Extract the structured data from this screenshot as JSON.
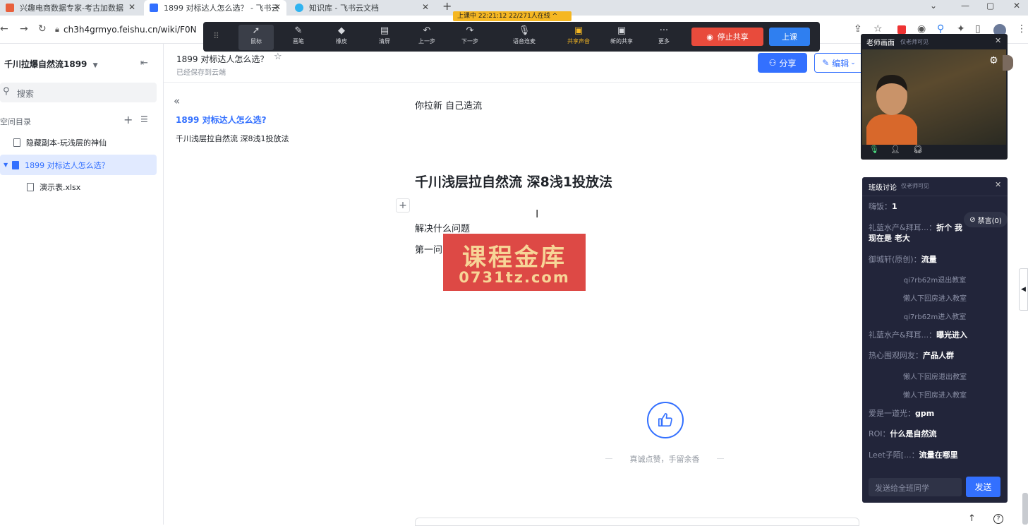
{
  "browser": {
    "tabs": [
      {
        "title": "兴趣电商数据专家-考古加数据",
        "fav_color": "#e8603c"
      },
      {
        "title": "1899 对标达人怎么选？ - 飞书云",
        "fav_color": "#3370ff"
      },
      {
        "title": "知识库 - 飞书云文档",
        "fav_color": "#2fb3f0"
      }
    ],
    "url": "ch3h4grmyo.feishu.cn/wiki/F0N"
  },
  "teach_toolbar": {
    "live_badge": "上课中 22:21:12 22/271人在线 ^",
    "tools": [
      {
        "label": "鼠标",
        "icon": "cursor-icon"
      },
      {
        "label": "画笔",
        "icon": "pen-icon"
      },
      {
        "label": "橡皮",
        "icon": "eraser-icon"
      },
      {
        "label": "清屏",
        "icon": "clear-screen-icon"
      },
      {
        "label": "上一步",
        "icon": "undo-icon"
      },
      {
        "label": "下一步",
        "icon": "redo-icon"
      },
      {
        "label": "语音连麦",
        "icon": "mic-icon"
      },
      {
        "label": "共享声音",
        "icon": "share-audio-icon"
      },
      {
        "label": "新的共享",
        "icon": "new-share-icon"
      },
      {
        "label": "更多",
        "icon": "more-icon"
      }
    ],
    "stop_share": "停止共享",
    "start_class": "上课"
  },
  "sidebar": {
    "space_name": "千川拉爆自然流1899",
    "search_placeholder": "搜索",
    "dir_label": "空间目录",
    "items": [
      {
        "label": "隐藏副本-玩浅层的神仙"
      },
      {
        "label": "1899 对标达人怎么选？"
      },
      {
        "label": "演示表.xlsx"
      }
    ]
  },
  "doc_header": {
    "title": "1899 对标达人怎么选？",
    "saved": "已经保存到云端",
    "share": "分享",
    "edit": "编辑"
  },
  "toc": {
    "title": "1899 对标达人怎么选?",
    "item": "千川浅层拉自然流 深8浅1投放法"
  },
  "content": {
    "line1": "你拉新  自己造流",
    "heading": "千川浅层拉自然流 深8浅1投放法",
    "para1": "解决什么问题",
    "para2": "第一问"
  },
  "watermark": {
    "line1": "课程金库",
    "line2": "0731tz.com"
  },
  "like": {
    "caption": "真诚点赞，手留余香"
  },
  "teacher_panel": {
    "title": "老师画面",
    "subtitle": "仅老师可见"
  },
  "chat": {
    "title": "班级讨论",
    "subtitle": "仅老师可见",
    "mute": "禁言(0)",
    "messages": [
      {
        "kind": "msg",
        "name": "嗨饭：",
        "text": "1"
      },
      {
        "kind": "msg",
        "name": "礼蓝水产&拜耳...：",
        "text": "折个  我现在是 老大"
      },
      {
        "kind": "msg",
        "name": "御城轩(原创)：",
        "text": "流量"
      },
      {
        "kind": "sys",
        "text": "qi7rb62m退出教室"
      },
      {
        "kind": "sys",
        "text": "懒人下回房进入教室"
      },
      {
        "kind": "sys",
        "text": "qi7rb62m进入教室"
      },
      {
        "kind": "msg",
        "name": "礼蓝水产&拜耳...：",
        "text": "曝光进入"
      },
      {
        "kind": "msg",
        "name": "热心围观网友：",
        "text": "产品人群"
      },
      {
        "kind": "sys",
        "text": "懒人下回房退出教室"
      },
      {
        "kind": "sys",
        "text": "懒人下回房进入教室"
      },
      {
        "kind": "msg",
        "name": "爱是一道光：",
        "text": "gpm"
      },
      {
        "kind": "msg",
        "name": "ROI：",
        "text": "什么是自然流"
      },
      {
        "kind": "msg",
        "name": "Leet子陌[...：",
        "text": "流量在哪里"
      }
    ],
    "input_placeholder": "发送给全班同学",
    "send": "发送"
  }
}
